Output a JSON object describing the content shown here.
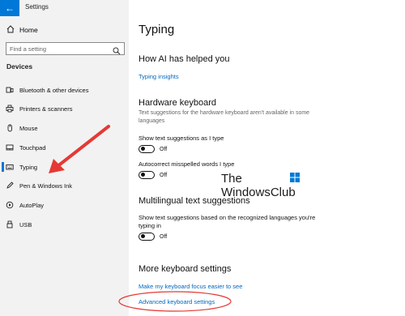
{
  "window": {
    "title": "Settings"
  },
  "sidebar": {
    "home_label": "Home",
    "search_placeholder": "Find a setting",
    "section_title": "Devices",
    "items": [
      {
        "label": "Bluetooth & other devices",
        "icon": "bluetooth-icon"
      },
      {
        "label": "Printers & scanners",
        "icon": "printer-icon"
      },
      {
        "label": "Mouse",
        "icon": "mouse-icon"
      },
      {
        "label": "Touchpad",
        "icon": "touchpad-icon"
      },
      {
        "label": "Typing",
        "icon": "keyboard-icon",
        "selected": true
      },
      {
        "label": "Pen & Windows Ink",
        "icon": "pen-icon"
      },
      {
        "label": "AutoPlay",
        "icon": "autoplay-icon"
      },
      {
        "label": "USB",
        "icon": "usb-icon"
      }
    ]
  },
  "main": {
    "title": "Typing",
    "ai_section": {
      "heading": "How AI has helped you",
      "link": "Typing insights"
    },
    "hardware_section": {
      "heading": "Hardware keyboard",
      "description": "Text suggestions for the hardware keyboard aren't available in some languages",
      "setting1_label": "Show text suggestions as I type",
      "setting1_state": "Off",
      "setting2_label": "Autocorrect misspelled words I type",
      "setting2_state": "Off"
    },
    "multilingual_section": {
      "heading": "Multilingual text suggestions",
      "label": "Show text suggestions based on the recognized languages you're typing in",
      "state": "Off"
    },
    "more_section": {
      "heading": "More keyboard settings",
      "link1": "Make my keyboard focus easier to see",
      "link2": "Advanced keyboard settings"
    }
  },
  "watermark": {
    "line1": "The",
    "line2": "WindowsClub"
  },
  "colors": {
    "accent": "#0078d7",
    "link": "#0067c0",
    "annotation": "#e53935"
  }
}
